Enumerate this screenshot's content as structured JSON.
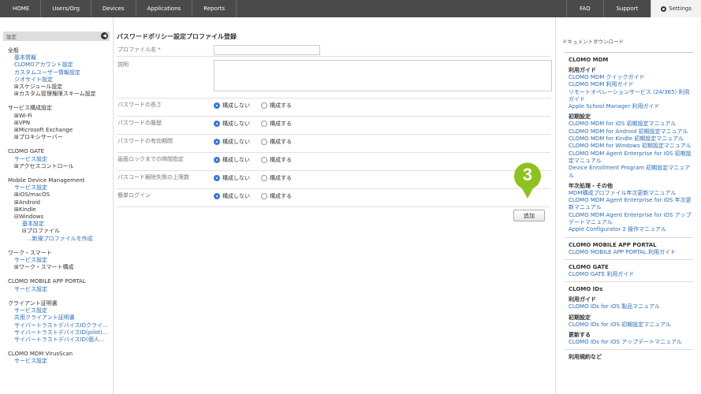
{
  "topnav": {
    "left": [
      "HOME",
      "Users/Org",
      "Devices",
      "Applications",
      "Reports"
    ],
    "right": [
      "FAQ",
      "Support"
    ],
    "settings": "Settings"
  },
  "sidebar": {
    "header": "設定",
    "groups": [
      {
        "title": "全般",
        "links": [
          {
            "text": "基本情報",
            "level": 1
          },
          {
            "text": "CLOMOアカウント設定",
            "level": 1
          },
          {
            "text": "カスタムユーザー情報設定",
            "level": 1
          },
          {
            "text": "ジオサイト設定",
            "level": 1
          },
          {
            "text": "⊞スケジュール設定",
            "level": 1,
            "dark": true
          },
          {
            "text": "⊞カスタム管理権限スキーム設定",
            "level": 1,
            "dark": true
          }
        ]
      },
      {
        "title": "サービス構成設定",
        "links": [
          {
            "text": "⊞Wi-Fi",
            "level": 1,
            "dark": true
          },
          {
            "text": "⊞VPN",
            "level": 1,
            "dark": true
          },
          {
            "text": "⊞Microsoft Exchange",
            "level": 1,
            "dark": true
          },
          {
            "text": "⊞プロキシサーバー",
            "level": 1,
            "dark": true
          }
        ]
      },
      {
        "title": "CLOMO GATE",
        "links": [
          {
            "text": "サービス設定",
            "level": 1
          },
          {
            "text": "⊞アクセスコントロール",
            "level": 1,
            "dark": true
          }
        ]
      },
      {
        "title": "Mobile Device Management",
        "links": [
          {
            "text": "サービス設定",
            "level": 1
          },
          {
            "text": "⊞iOS/macOS",
            "level": 1,
            "dark": true
          },
          {
            "text": "⊞Android",
            "level": 1,
            "dark": true
          },
          {
            "text": "⊞Kindle",
            "level": 1,
            "dark": true
          },
          {
            "text": "⊟Windows",
            "level": 1,
            "dark": true
          },
          {
            "text": "基本設定",
            "level": 2
          },
          {
            "text": "⊟プロファイル",
            "level": 2,
            "dark": true
          },
          {
            "text": "...新規プロファイルを作成",
            "level": 3
          }
        ]
      },
      {
        "title": "ワーク・スマート",
        "links": [
          {
            "text": "サービス設定",
            "level": 1
          },
          {
            "text": "⊞ワーク・スマート構成",
            "level": 1,
            "dark": true
          }
        ]
      },
      {
        "title": "CLOMO MOBILE APP PORTAL",
        "links": [
          {
            "text": "サービス設定",
            "level": 1
          }
        ]
      },
      {
        "title": "クライアント証明書",
        "links": [
          {
            "text": "サービス設定",
            "level": 1
          },
          {
            "text": "共用クライアント証明書",
            "level": 1
          },
          {
            "text": "サイバートラストデバイスIDクライ...",
            "level": 1
          },
          {
            "text": "サイバートラストデバイスID(pilot)...",
            "level": 1
          },
          {
            "text": "サイバートラストデバイスID(個人...",
            "level": 1
          }
        ]
      },
      {
        "title": "CLOMO MDM VirusScan",
        "links": [
          {
            "text": "サービス設定",
            "level": 1
          }
        ]
      }
    ]
  },
  "main": {
    "title": "パスワードポリシー設定プロファイル登録",
    "profile_name_label": "プロファイル名",
    "required_mark": "*",
    "description_label": "説明",
    "rows": [
      {
        "label": "パスワードの長さ"
      },
      {
        "label": "パスワードの履歴"
      },
      {
        "label": "パスワードの有効期間"
      },
      {
        "label": "画面ロックまでの時間指定"
      },
      {
        "label": "パスコード解除失敗の上限数"
      },
      {
        "label": "簡単ログイン"
      }
    ],
    "opt_off": "構成しない",
    "opt_on": "構成する",
    "add_button": "追加",
    "callout_number": "3"
  },
  "docs": {
    "title": "ドキュメントダウンロード",
    "sections": [
      {
        "heading": "CLOMO MDM",
        "subs": [
          {
            "sub": "利用ガイド",
            "links": [
              "CLOMO MDM クイックガイド",
              "CLOMO MDM 利用ガイド",
              "リモートオペレーションサービス (24/365) 利用ガイド",
              "Apple School Manager 利用ガイド"
            ]
          },
          {
            "sub": "初期設定",
            "links": [
              "CLOMO MDM for iOS 初期設定マニュアル",
              "CLOMO MDM for Android 初期設定マニュアル",
              "CLOMO MDM for Kindle 初期設定マニュアル",
              "CLOMO MDM for Windows 初期設定マニュアル",
              "CLOMO MDM Agent Enterprise for iOS 初期設定マニュアル",
              "Device Enrollment Program 初期設定マニュアル"
            ]
          },
          {
            "sub": "年次処理・その他",
            "links": [
              "MDM構成プロファイル年次更新マニュアル",
              "CLOMO MDM Agent Enterprise for iOS 年次更新マニュアル",
              "CLOMO MDM Agent Enterprise for iOS アップデートマニュアル",
              "Apple Configurator 2 操作マニュアル"
            ]
          }
        ]
      },
      {
        "heading": "CLOMO MOBILE APP PORTAL",
        "subs": [
          {
            "sub": "",
            "links": [
              "CLOMO MOBILE APP PORTAL 利用ガイド"
            ]
          }
        ]
      },
      {
        "heading": "CLOMO GATE",
        "subs": [
          {
            "sub": "",
            "links": [
              "CLOMO GATE 利用ガイド"
            ]
          }
        ]
      },
      {
        "heading": "CLOMO IDs",
        "subs": [
          {
            "sub": "利用ガイド",
            "links": [
              "CLOMO IDs for iOS 製品マニュアル"
            ]
          },
          {
            "sub": "初期設定",
            "links": [
              "CLOMO IDs for iOS 初期設定マニュアル"
            ]
          },
          {
            "sub": "更新する",
            "links": [
              "CLOMO IDs for iOS アップデートマニュアル"
            ]
          }
        ]
      },
      {
        "heading": "利用規約など",
        "subs": []
      }
    ]
  },
  "colors": {
    "topbar": "#4a4a4a",
    "link": "#2a6db5",
    "callout": "#8dc21f",
    "radio_on": "#3a7bd5"
  }
}
